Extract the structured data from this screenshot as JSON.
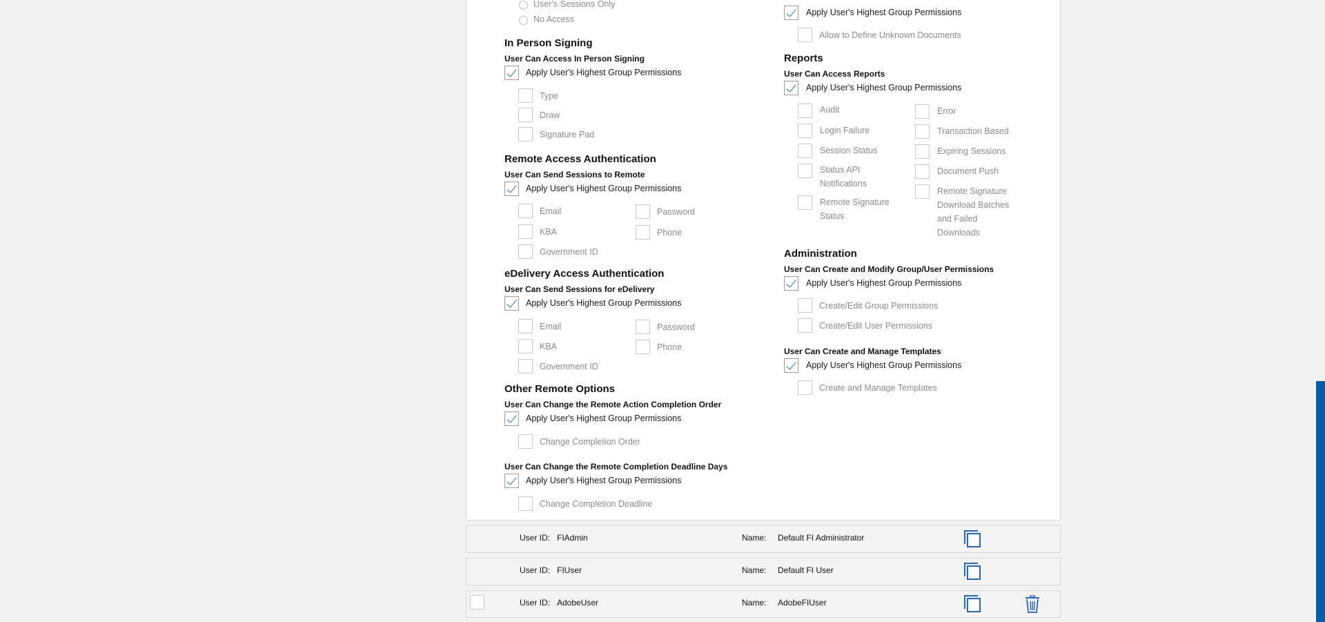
{
  "top": {
    "radio_sessions_only": "User's Sessions Only",
    "radio_no_access": "No Access",
    "apply": "Apply User's Highest Group Permissions",
    "allow_unknown": "Allow to Define Unknown Documents"
  },
  "in_person": {
    "title": "In Person Signing",
    "subtitle": "User Can Access In Person Signing",
    "apply": "Apply User's Highest Group Permissions",
    "options": [
      "Type",
      "Draw",
      "Signature Pad"
    ]
  },
  "remote_auth": {
    "title": "Remote Access Authentication",
    "subtitle": "User Can Send Sessions to Remote",
    "apply": "Apply User's Highest Group Permissions",
    "options": [
      "Email",
      "Password",
      "KBA",
      "Phone",
      "Government ID"
    ]
  },
  "edelivery_auth": {
    "title": "eDelivery Access Authentication",
    "subtitle": "User Can Send Sessions for eDelivery",
    "apply": "Apply User's Highest Group Permissions",
    "options": [
      "Email",
      "Password",
      "KBA",
      "Phone",
      "Government ID"
    ]
  },
  "other_remote": {
    "title": "Other Remote Options",
    "order_subtitle": "User Can Change the Remote Action Completion Order",
    "order_apply": "Apply User's Highest Group Permissions",
    "order_option": "Change Completion Order",
    "deadline_subtitle": "User Can Change the Remote Completion Deadline Days",
    "deadline_apply": "Apply User's Highest Group Permissions",
    "deadline_option": "Change Completion Deadline"
  },
  "reports": {
    "title": "Reports",
    "subtitle": "User Can Access Reports",
    "apply": "Apply User's Highest Group Permissions",
    "left": [
      "Audit",
      "Login Failure",
      "Session Status",
      "Status API Notifications",
      "Remote Signature Status"
    ],
    "right": [
      "Error",
      "Transaction Based",
      "Expiring Sessions",
      "Document Push",
      "Remote Signature Download Batches and Failed Downloads"
    ]
  },
  "administration": {
    "title": "Administration",
    "perm_subtitle": "User Can Create and Modify Group/User Permissions",
    "perm_apply": "Apply User's Highest Group Permissions",
    "perm_options": [
      "Create/Edit Group Permissions",
      "Create/Edit User Permissions"
    ],
    "tmpl_subtitle": "User Can Create and Manage Templates",
    "tmpl_apply": "Apply User's Highest Group Permissions",
    "tmpl_option": "Create and Manage Templates"
  },
  "users": [
    {
      "id_label": "User ID:",
      "id": "FIAdmin",
      "name_label": "Name:",
      "name": "Default FI Administrator"
    },
    {
      "id_label": "User ID:",
      "id": "FIUser",
      "name_label": "Name:",
      "name": "Default FI User"
    },
    {
      "id_label": "User ID:",
      "id": "AdobeUser",
      "name_label": "Name:",
      "name": "AdobeFIUser"
    }
  ],
  "icons": {
    "copy": "copy-icon",
    "trash": "trash-icon"
  },
  "colors": {
    "accent": "#2a66ad",
    "scroll_accent": "#0a5aa6"
  }
}
